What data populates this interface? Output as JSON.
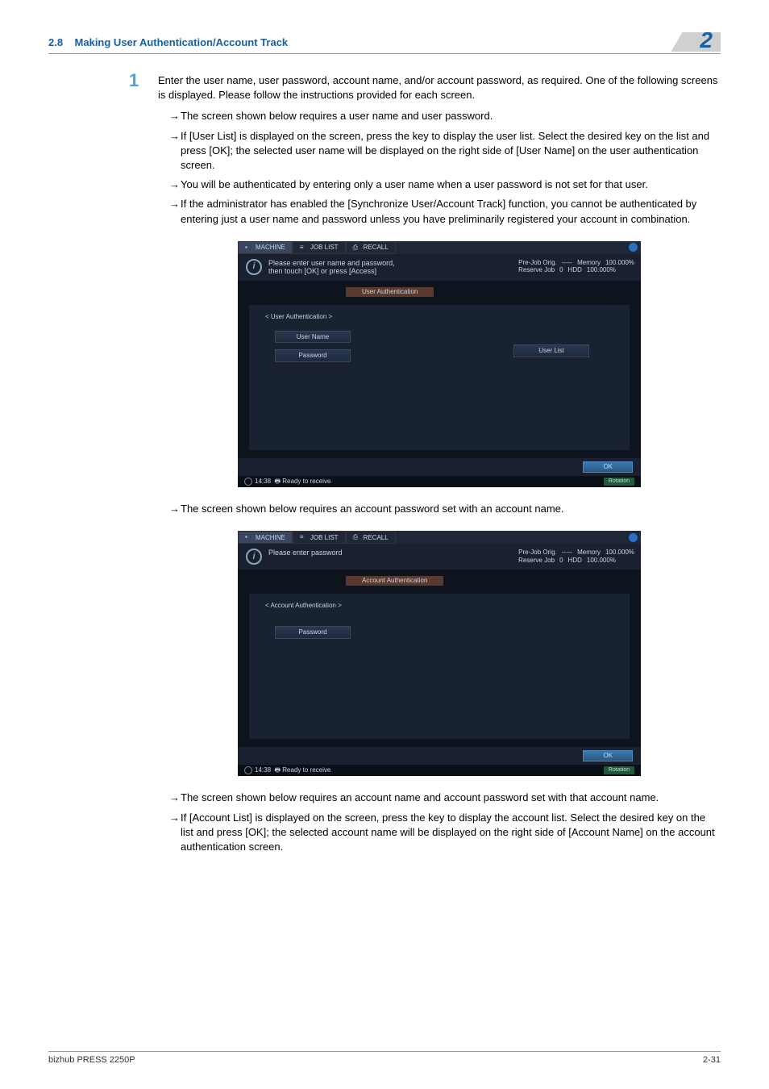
{
  "header": {
    "section_num": "2.8",
    "section_title": "Making User Authentication/Account Track",
    "chapter_num": "2"
  },
  "step": {
    "num": "1",
    "text": "Enter the user name, user password, account name, and/or account password, as required. One of the following screens is displayed. Please follow the instructions provided for each screen."
  },
  "bullets1": [
    "The screen shown below requires a user name and user password.",
    "If [User List] is displayed on the screen, press the key to display the user list. Select the desired key on the list and press [OK]; the selected user name will be displayed on the right side of [User Name] on the user authentication screen.",
    "You will be authenticated by entering only a user name when a user password is not set for that user.",
    "If the administrator has enabled the [Synchronize User/Account Track] function, you cannot be authenticated by entering just a user name and password unless you have preliminarily registered your account in combination."
  ],
  "bullets2": [
    "The screen shown below requires an account password set with an account name."
  ],
  "bullets3": [
    "The screen shown below requires an account name and account password set with that account name.",
    "If [Account List] is displayed on the screen, press the key to display the account list. Select the desired key on the list and press [OK]; the selected account name will be displayed on the right side of [Account Name] on the account authentication screen."
  ],
  "ss_common": {
    "tab_machine": "MACHINE",
    "tab_joblist": "JOB LIST",
    "tab_recall": "RECALL",
    "stat_prejob": "Pre-Job Orig.",
    "stat_prejob_dash": "-----",
    "stat_mem": "Memory",
    "stat_mem_val": "100.000%",
    "stat_reserve": "Reserve Job",
    "stat_reserve_val": "0",
    "stat_hdd": "HDD",
    "stat_hdd_val": "100.000%",
    "ok": "OK",
    "time": "14:38",
    "ready": "Ready to receive",
    "rotation": "Rotation"
  },
  "ss1": {
    "info": "Please enter user name and password,\nthen touch [OK] or press [Access]",
    "tab": "User Authentication",
    "section": "< User Authentication >",
    "btn_user": "User Name",
    "btn_pass": "Password",
    "btn_list": "User List"
  },
  "ss2": {
    "info": "Please enter password",
    "tab": "Account Authentication",
    "section": "< Account Authentication >",
    "btn_pass": "Password"
  },
  "footer": {
    "model": "bizhub PRESS 2250P",
    "page": "2-31"
  }
}
